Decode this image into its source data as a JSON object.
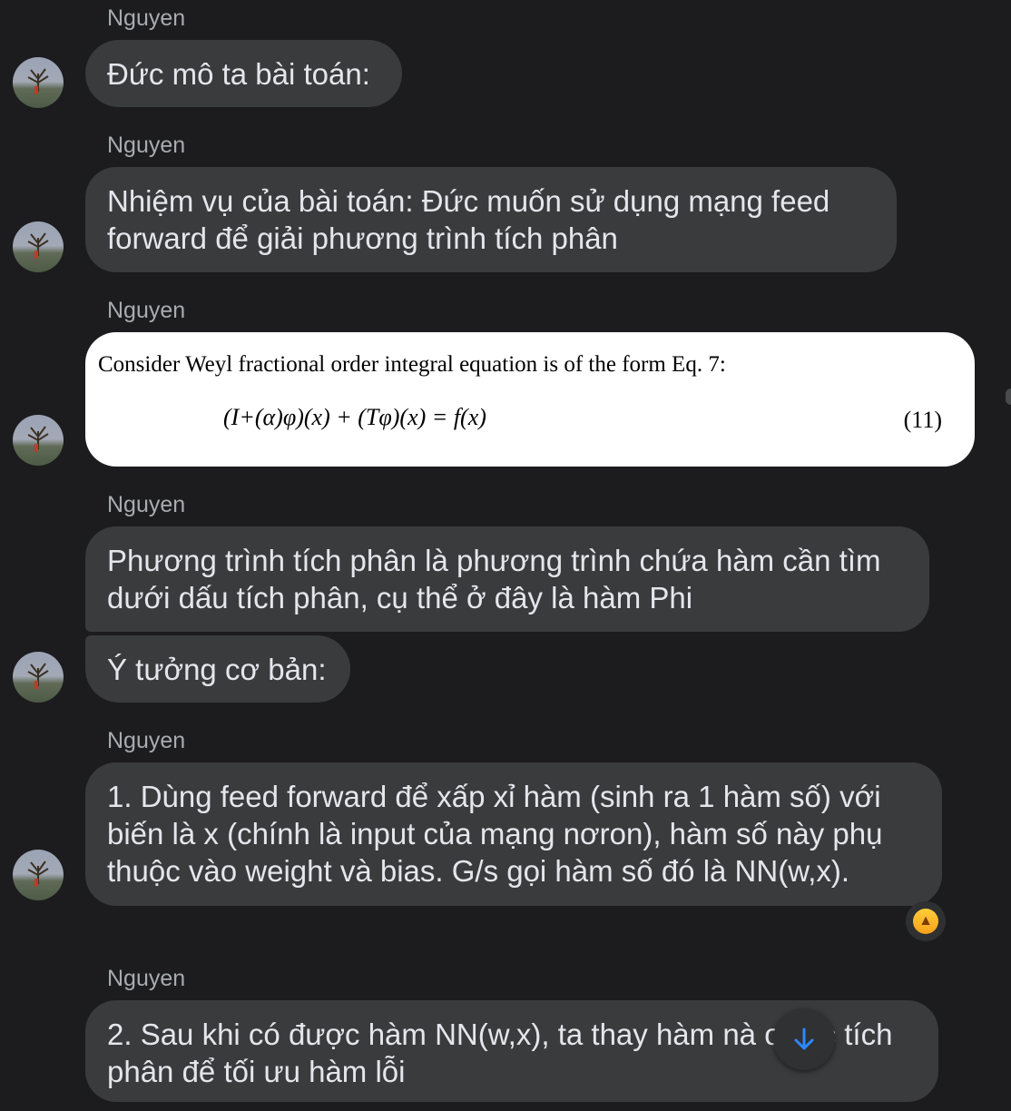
{
  "messages": [
    {
      "sender": "Nguyen",
      "text": "Đức mô ta bài toán:"
    },
    {
      "sender": "Nguyen",
      "text": "Nhiệm vụ của bài toán:  Đức muốn sử dụng mạng feed forward để giải phương trình tích phân"
    },
    {
      "sender": "Nguyen",
      "image": {
        "line1": "Consider Weyl fractional order integral equation is of the form Eq. 7:",
        "equation": "(I+(α)φ)(x) + (Tφ)(x) = f(x)",
        "eq_number": "(11)"
      }
    },
    {
      "sender": "Nguyen",
      "text": "Phương trình tích phân là phương trình chứa hàm cần tìm dưới dấu tích phân, cụ thể ở đây là hàm Phi"
    },
    {
      "text": "Ý tưởng cơ bản:"
    },
    {
      "sender": "Nguyen",
      "text": "1. Dùng feed forward để xấp xỉ hàm (sinh ra 1 hàm số) với biến là x (chính là input của mạng nơron), hàm số này phụ thuộc vào weight và bias. G/s gọi hàm số đó là NN(w,x).",
      "reaction": "thumbs-up"
    },
    {
      "sender": "Nguyen",
      "text": "2. Sau khi có được hàm NN(w,x), ta thay hàm nà    o các tích phân để tối ưu hàm lỗi"
    }
  ],
  "icons": {
    "avatar": "avatar-photo",
    "reaction": "thumbs-up-icon",
    "scroll": "arrow-down-icon"
  },
  "colors": {
    "background": "#1c1c1e",
    "bubble": "#3a3b3d",
    "text": "#e4e6eb",
    "sender": "#a8abb0",
    "accent": "#2d88ff"
  }
}
